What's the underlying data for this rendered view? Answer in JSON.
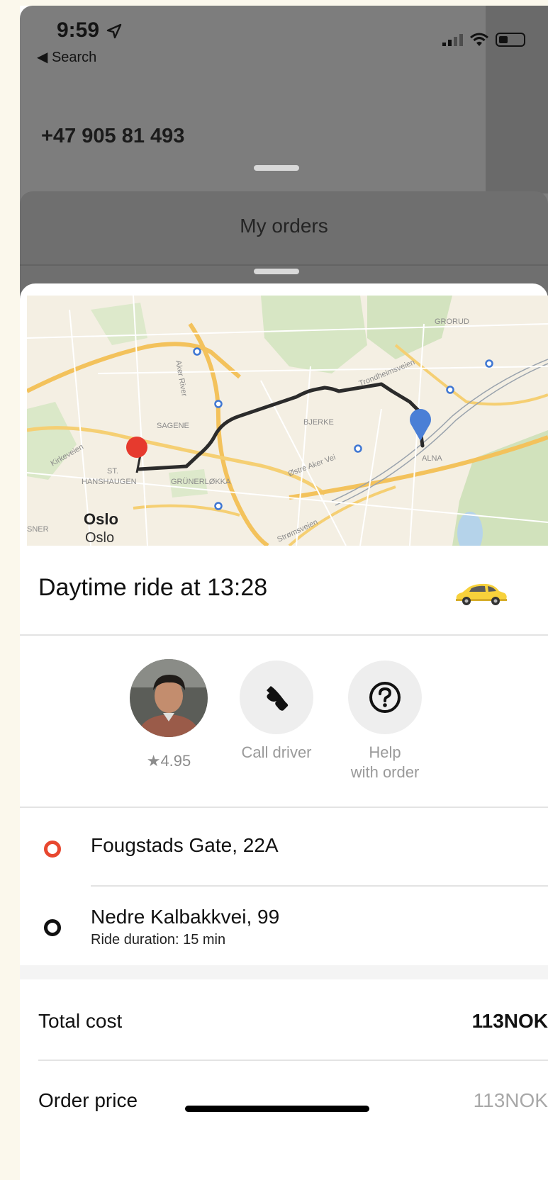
{
  "status_bar": {
    "time": "9:59",
    "back_label": "◀ Search"
  },
  "background": {
    "phone_number": "+47 905 81 493",
    "orders_title": "My orders"
  },
  "ride": {
    "title": "Daytime ride at 13:28"
  },
  "map": {
    "labels": {
      "grorud": "GRORUD",
      "sagene": "SAGENE",
      "bjerke": "BJERKE",
      "alna": "ALNA",
      "st": "ST.",
      "hanshaugen": "HANSHAUGEN",
      "grunerlokka": "GRÜNERLØKKA",
      "kirkeveien": "Kirkeveien",
      "aker_river": "Aker River",
      "trondheimsveien": "Trondheimsveien",
      "ostre_aker_vei": "Østre Aker Vei",
      "stromsveien": "Strømsveien",
      "oslo_bold": "Oslo",
      "oslo": "Oslo",
      "sner": "SNER"
    }
  },
  "actions": {
    "rating": "★4.95",
    "call_driver": "Call driver",
    "help_line1": "Help",
    "help_line2": "with order"
  },
  "route": {
    "from": "Fougstads Gate, 22A",
    "to": "Nedre Kalbakkvei, 99",
    "duration": "Ride duration: 15 min"
  },
  "costs": {
    "total_label": "Total cost",
    "total_value": "113NOK",
    "order_label": "Order price",
    "order_value": "113NOK"
  },
  "colors": {
    "origin": "#e8472f",
    "destination": "#111111",
    "route_start_pin": "#e63a2e",
    "route_end_pin": "#4a7fd6",
    "taxi": "#f7d13b"
  }
}
